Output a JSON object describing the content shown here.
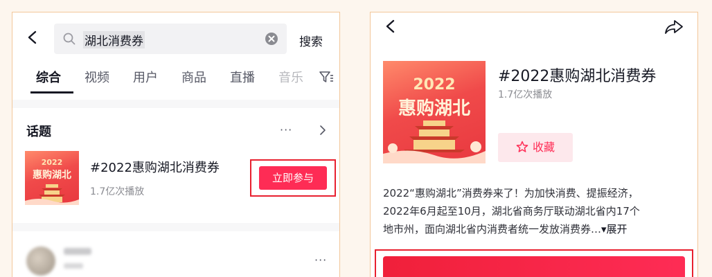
{
  "left": {
    "search": {
      "query": "湖北消费券",
      "button_label": "搜索"
    },
    "tabs": [
      {
        "label": "综合"
      },
      {
        "label": "视频"
      },
      {
        "label": "用户"
      },
      {
        "label": "商品"
      },
      {
        "label": "直播"
      },
      {
        "label": "音乐"
      }
    ],
    "topic_section": {
      "header": "话题",
      "more": "···",
      "item": {
        "thumb_year": "2022",
        "thumb_title": "惠购湖北",
        "name": "#2022惠购湖北消费券",
        "plays": "1.7亿次播放",
        "join_label": "立即参与"
      }
    },
    "user_more": "···"
  },
  "right": {
    "topic": {
      "thumb_year": "2022",
      "thumb_title": "惠购湖北",
      "name": "#2022惠购湖北消费券",
      "plays": "1.7亿次播放",
      "favorite_label": "收藏"
    },
    "description": {
      "line1": "2022“惠购湖北”消费券来了！为加快消费、提振经济，",
      "line2": "2022年6月起至10月，湖北省商务厅联动湖北省内17个",
      "line3": "地市州，面向湖北省内消费者统一发放消费券…",
      "expand": "▾展开"
    }
  },
  "colors": {
    "accent": "#fe2c55",
    "highlight_border": "#e8202f",
    "panel_border": "#f2c79a",
    "background": "#fdf6ee"
  }
}
